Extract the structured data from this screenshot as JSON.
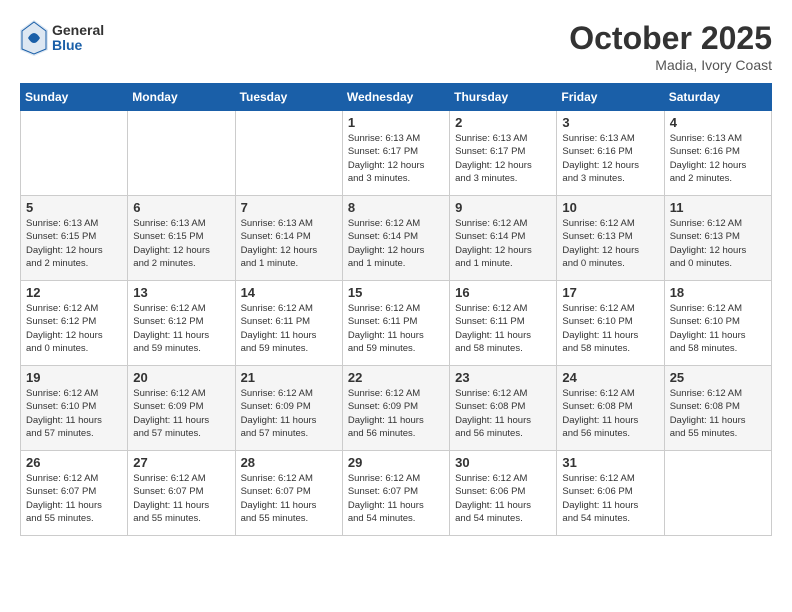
{
  "header": {
    "logo_general": "General",
    "logo_blue": "Blue",
    "month_year": "October 2025",
    "location": "Madia, Ivory Coast"
  },
  "weekdays": [
    "Sunday",
    "Monday",
    "Tuesday",
    "Wednesday",
    "Thursday",
    "Friday",
    "Saturday"
  ],
  "weeks": [
    [
      {
        "day": "",
        "info": ""
      },
      {
        "day": "",
        "info": ""
      },
      {
        "day": "",
        "info": ""
      },
      {
        "day": "1",
        "info": "Sunrise: 6:13 AM\nSunset: 6:17 PM\nDaylight: 12 hours\nand 3 minutes."
      },
      {
        "day": "2",
        "info": "Sunrise: 6:13 AM\nSunset: 6:17 PM\nDaylight: 12 hours\nand 3 minutes."
      },
      {
        "day": "3",
        "info": "Sunrise: 6:13 AM\nSunset: 6:16 PM\nDaylight: 12 hours\nand 3 minutes."
      },
      {
        "day": "4",
        "info": "Sunrise: 6:13 AM\nSunset: 6:16 PM\nDaylight: 12 hours\nand 2 minutes."
      }
    ],
    [
      {
        "day": "5",
        "info": "Sunrise: 6:13 AM\nSunset: 6:15 PM\nDaylight: 12 hours\nand 2 minutes."
      },
      {
        "day": "6",
        "info": "Sunrise: 6:13 AM\nSunset: 6:15 PM\nDaylight: 12 hours\nand 2 minutes."
      },
      {
        "day": "7",
        "info": "Sunrise: 6:13 AM\nSunset: 6:14 PM\nDaylight: 12 hours\nand 1 minute."
      },
      {
        "day": "8",
        "info": "Sunrise: 6:12 AM\nSunset: 6:14 PM\nDaylight: 12 hours\nand 1 minute."
      },
      {
        "day": "9",
        "info": "Sunrise: 6:12 AM\nSunset: 6:14 PM\nDaylight: 12 hours\nand 1 minute."
      },
      {
        "day": "10",
        "info": "Sunrise: 6:12 AM\nSunset: 6:13 PM\nDaylight: 12 hours\nand 0 minutes."
      },
      {
        "day": "11",
        "info": "Sunrise: 6:12 AM\nSunset: 6:13 PM\nDaylight: 12 hours\nand 0 minutes."
      }
    ],
    [
      {
        "day": "12",
        "info": "Sunrise: 6:12 AM\nSunset: 6:12 PM\nDaylight: 12 hours\nand 0 minutes."
      },
      {
        "day": "13",
        "info": "Sunrise: 6:12 AM\nSunset: 6:12 PM\nDaylight: 11 hours\nand 59 minutes."
      },
      {
        "day": "14",
        "info": "Sunrise: 6:12 AM\nSunset: 6:11 PM\nDaylight: 11 hours\nand 59 minutes."
      },
      {
        "day": "15",
        "info": "Sunrise: 6:12 AM\nSunset: 6:11 PM\nDaylight: 11 hours\nand 59 minutes."
      },
      {
        "day": "16",
        "info": "Sunrise: 6:12 AM\nSunset: 6:11 PM\nDaylight: 11 hours\nand 58 minutes."
      },
      {
        "day": "17",
        "info": "Sunrise: 6:12 AM\nSunset: 6:10 PM\nDaylight: 11 hours\nand 58 minutes."
      },
      {
        "day": "18",
        "info": "Sunrise: 6:12 AM\nSunset: 6:10 PM\nDaylight: 11 hours\nand 58 minutes."
      }
    ],
    [
      {
        "day": "19",
        "info": "Sunrise: 6:12 AM\nSunset: 6:10 PM\nDaylight: 11 hours\nand 57 minutes."
      },
      {
        "day": "20",
        "info": "Sunrise: 6:12 AM\nSunset: 6:09 PM\nDaylight: 11 hours\nand 57 minutes."
      },
      {
        "day": "21",
        "info": "Sunrise: 6:12 AM\nSunset: 6:09 PM\nDaylight: 11 hours\nand 57 minutes."
      },
      {
        "day": "22",
        "info": "Sunrise: 6:12 AM\nSunset: 6:09 PM\nDaylight: 11 hours\nand 56 minutes."
      },
      {
        "day": "23",
        "info": "Sunrise: 6:12 AM\nSunset: 6:08 PM\nDaylight: 11 hours\nand 56 minutes."
      },
      {
        "day": "24",
        "info": "Sunrise: 6:12 AM\nSunset: 6:08 PM\nDaylight: 11 hours\nand 56 minutes."
      },
      {
        "day": "25",
        "info": "Sunrise: 6:12 AM\nSunset: 6:08 PM\nDaylight: 11 hours\nand 55 minutes."
      }
    ],
    [
      {
        "day": "26",
        "info": "Sunrise: 6:12 AM\nSunset: 6:07 PM\nDaylight: 11 hours\nand 55 minutes."
      },
      {
        "day": "27",
        "info": "Sunrise: 6:12 AM\nSunset: 6:07 PM\nDaylight: 11 hours\nand 55 minutes."
      },
      {
        "day": "28",
        "info": "Sunrise: 6:12 AM\nSunset: 6:07 PM\nDaylight: 11 hours\nand 55 minutes."
      },
      {
        "day": "29",
        "info": "Sunrise: 6:12 AM\nSunset: 6:07 PM\nDaylight: 11 hours\nand 54 minutes."
      },
      {
        "day": "30",
        "info": "Sunrise: 6:12 AM\nSunset: 6:06 PM\nDaylight: 11 hours\nand 54 minutes."
      },
      {
        "day": "31",
        "info": "Sunrise: 6:12 AM\nSunset: 6:06 PM\nDaylight: 11 hours\nand 54 minutes."
      },
      {
        "day": "",
        "info": ""
      }
    ]
  ]
}
